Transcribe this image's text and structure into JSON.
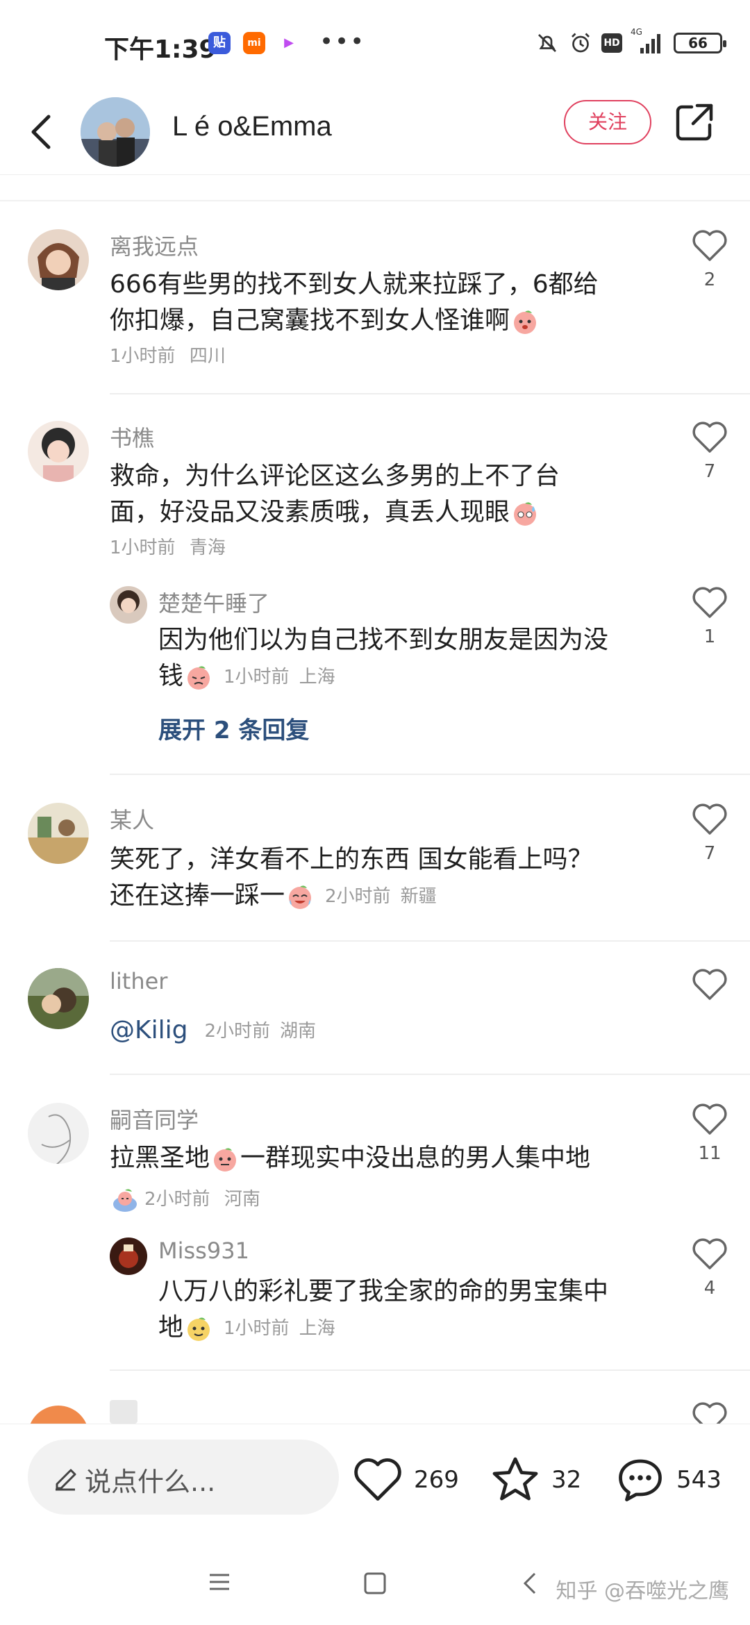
{
  "status_bar": {
    "time": "下午1:39",
    "battery": "66",
    "network": "4G",
    "hd": "HD",
    "apps": [
      "贴",
      "mi",
      "▶"
    ],
    "more": "•••"
  },
  "header": {
    "author_name": "L é o&Emma",
    "follow_label": "关注"
  },
  "comments": [
    {
      "user": "离我远点",
      "text_lines": [
        "666有些男的找不到女人就来拉踩了，6都给",
        "你扣爆，自己窝囊找不到女人怪谁啊"
      ],
      "time": "1小时前",
      "location": "四川",
      "likes": "2"
    },
    {
      "user": "书樵",
      "text_lines": [
        "救命，为什么评论区这么多男的上不了台",
        "面，好没品又没素质哦，真丢人现眼"
      ],
      "time": "1小时前",
      "location": "青海",
      "likes": "7",
      "reply": {
        "user": "楚楚午睡了",
        "text_lines": [
          "因为他们以为自己找不到女朋友是因为没",
          "钱"
        ],
        "time": "1小时前",
        "location": "上海",
        "likes": "1"
      },
      "expand_label": "展开 2 条回复"
    },
    {
      "user": "某人",
      "text_lines": [
        "笑死了，洋女看不上的东西 国女能看上吗？",
        "还在这捧一踩一"
      ],
      "time": "2小时前",
      "location": "新疆",
      "likes": "7"
    },
    {
      "user": "lither",
      "mention": "@Kilig",
      "time": "2小时前",
      "location": "湖南",
      "likes": ""
    },
    {
      "user": "嗣音同学",
      "text_lines": [
        "拉黑圣地",
        "一群现实中没出息的男人集中地"
      ],
      "time": "2小时前",
      "location": "河南",
      "likes": "11",
      "reply": {
        "user": "Miss931",
        "text_lines": [
          "八万八的彩礼要了我全家的命的男宝集中",
          "地"
        ],
        "time": "1小时前",
        "location": "上海",
        "likes": "4"
      }
    }
  ],
  "bottom_bar": {
    "input_placeholder": "说点什么...",
    "likes": "269",
    "stars": "32",
    "comments": "543"
  },
  "watermark": "知乎 @吞噬光之鹰",
  "colors": {
    "accent": "#e0405e",
    "link": "#2c4f7c",
    "secondary_text": "#8a8a8a"
  }
}
